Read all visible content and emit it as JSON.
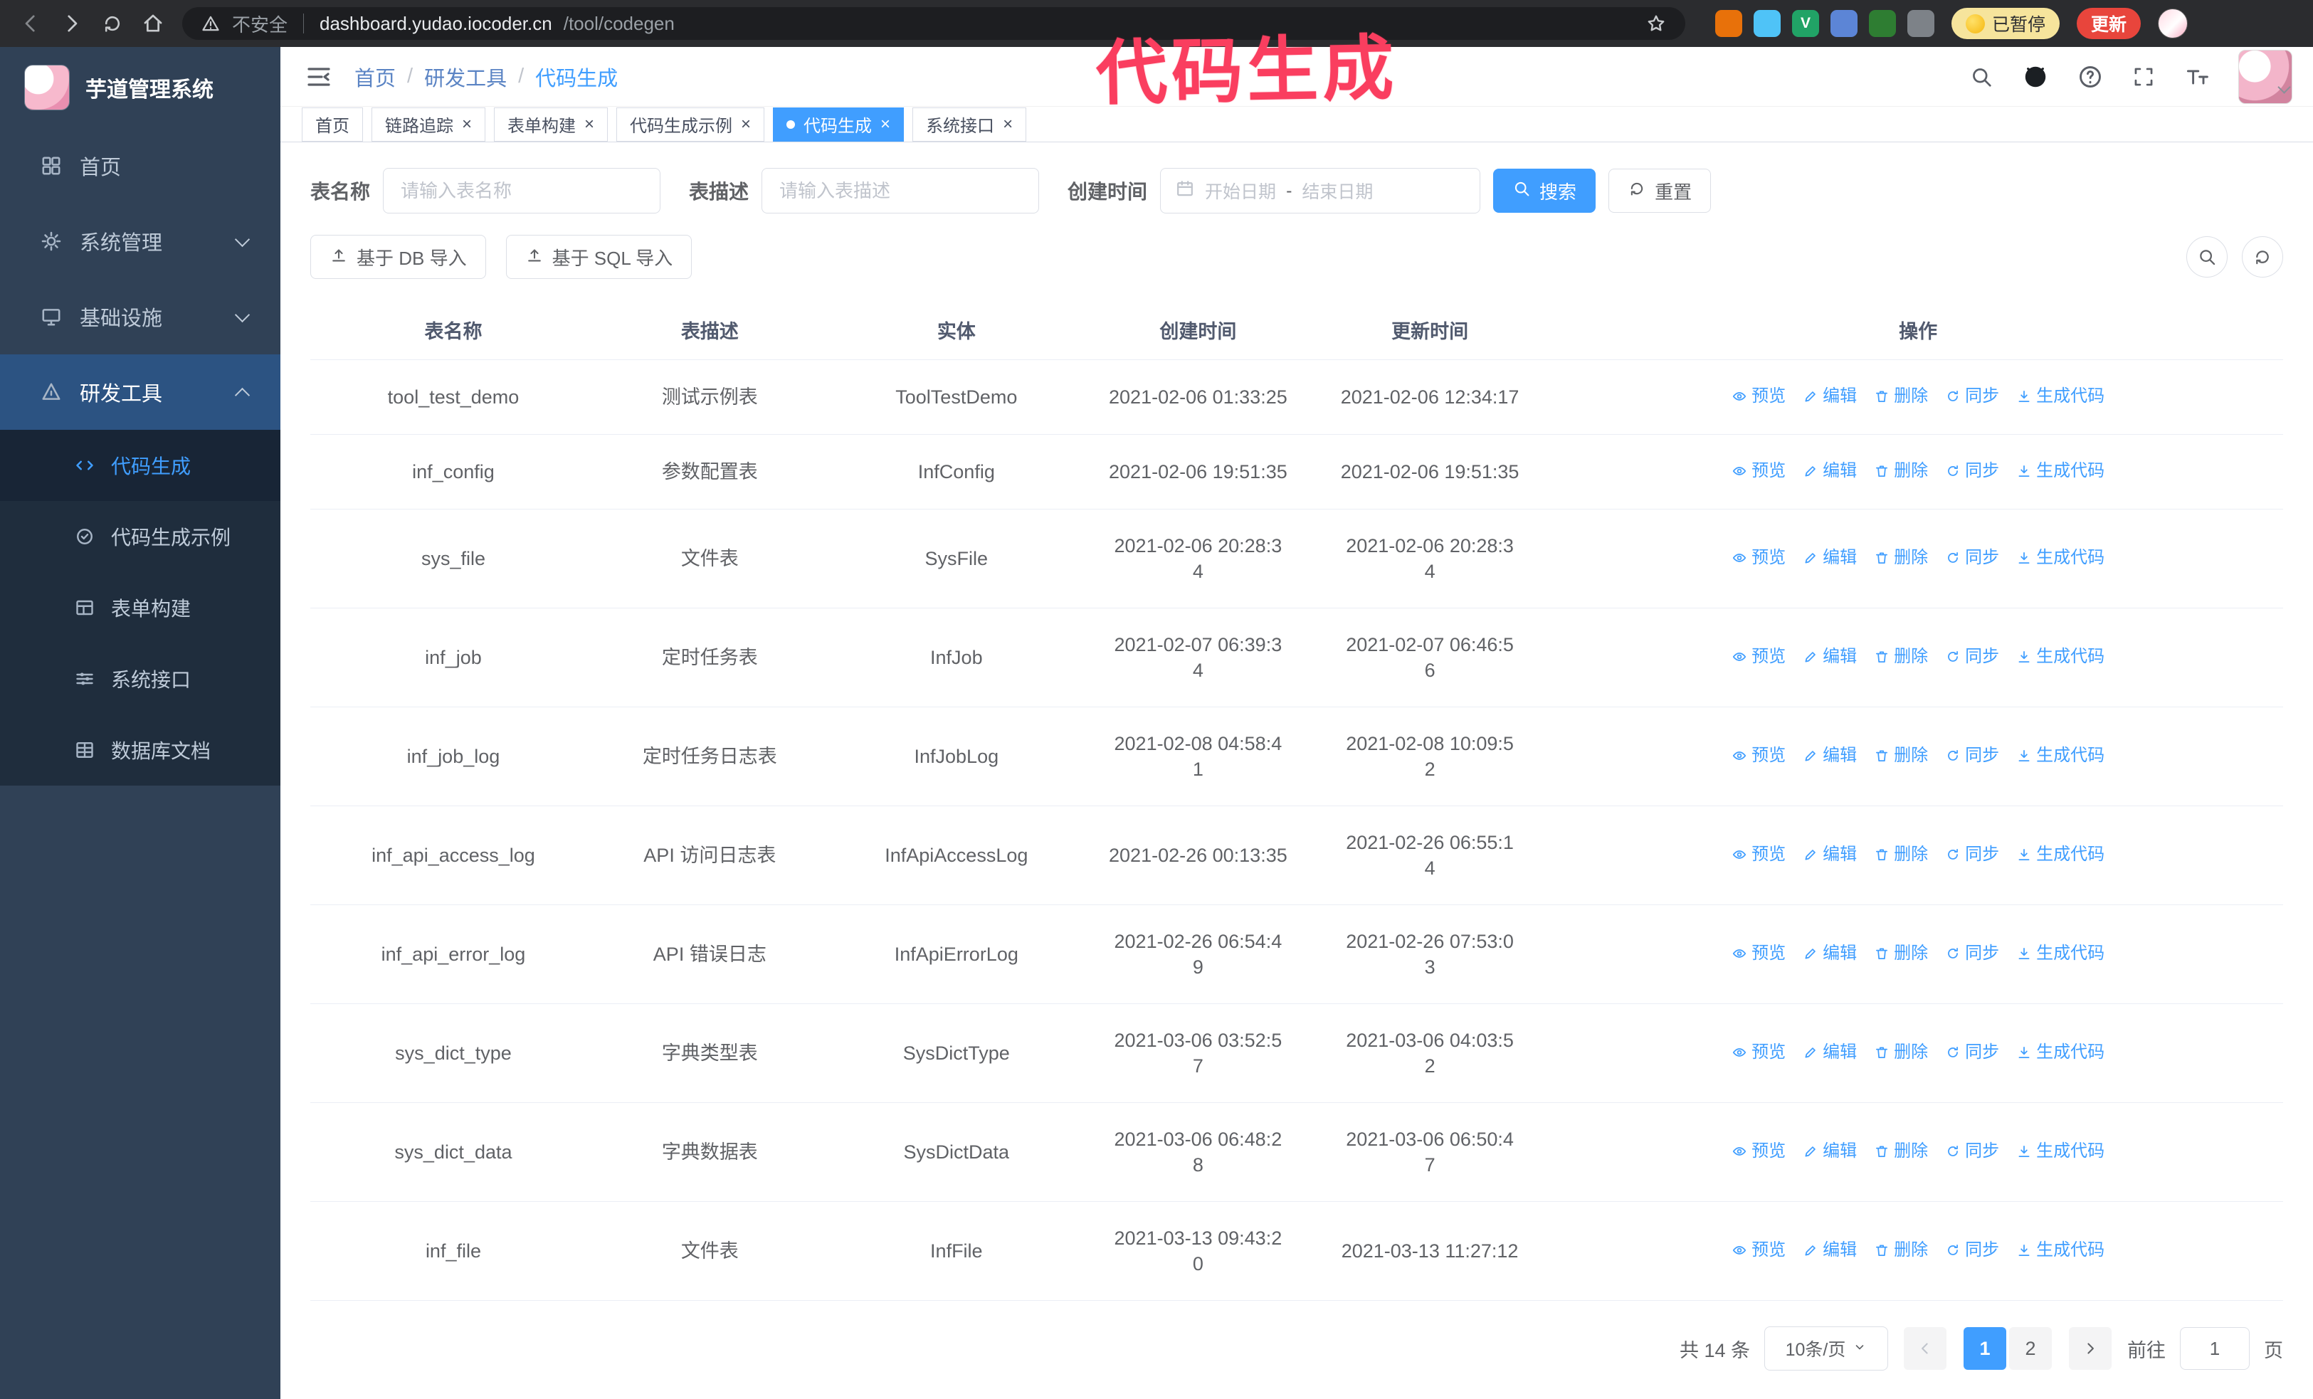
{
  "annotation": {
    "text": "代码生成",
    "color": "#fa3e5f"
  },
  "colors": {
    "primary": "#409eff",
    "sidebar_bg": "#304156",
    "submenu_bg": "#1f2d3d",
    "annotation": "#fa3e5f",
    "update_button": "#e8453c"
  },
  "browser": {
    "security_warning": "不安全",
    "url_host": "dashboard.yudao.iocoder.cn",
    "url_path": "/tool/codegen",
    "paused_badge": "已暂停",
    "update_button": "更新",
    "nav_icons": [
      "back-icon",
      "forward-icon",
      "reload-icon",
      "home2-icon"
    ],
    "extensions": [
      {
        "name": "extension-shield-icon",
        "color": "#e8710a",
        "label": ""
      },
      {
        "name": "extension-drop-icon",
        "color": "#4fc3f7",
        "label": ""
      },
      {
        "name": "extension-v-icon",
        "color": "#21a366",
        "label": "V"
      },
      {
        "name": "extension-people-icon",
        "color": "#5c85d6",
        "label": ""
      },
      {
        "name": "extension-leaf-icon",
        "color": "#2e7d32",
        "label": ""
      },
      {
        "name": "extension-puzzle-icon",
        "color": "#7d8288",
        "label": ""
      }
    ]
  },
  "sidebar": {
    "logo_title": "芋道管理系统",
    "items": [
      {
        "key": "home",
        "label": "首页",
        "icon": "home-icon",
        "expandable": false,
        "expanded": false
      },
      {
        "key": "system",
        "label": "系统管理",
        "icon": "gear-icon",
        "expandable": true,
        "expanded": false
      },
      {
        "key": "infra",
        "label": "基础设施",
        "icon": "infra-icon",
        "expandable": true,
        "expanded": false
      },
      {
        "key": "devtools",
        "label": "研发工具",
        "icon": "tools-icon",
        "expandable": true,
        "expanded": true,
        "children": [
          {
            "key": "codegen",
            "label": "代码生成",
            "icon": "code-icon",
            "active": true
          },
          {
            "key": "codegen-example",
            "label": "代码生成示例",
            "icon": "example-icon",
            "active": false
          },
          {
            "key": "form-builder",
            "label": "表单构建",
            "icon": "form-icon",
            "active": false
          },
          {
            "key": "system-api",
            "label": "系统接口",
            "icon": "api-icon",
            "active": false
          },
          {
            "key": "db-doc",
            "label": "数据库文档",
            "icon": "database-icon",
            "active": false
          }
        ]
      }
    ]
  },
  "header": {
    "breadcrumb": [
      "首页",
      "研发工具",
      "代码生成"
    ]
  },
  "tabs": [
    {
      "label": "首页",
      "closable": false,
      "active": false
    },
    {
      "label": "链路追踪",
      "closable": true,
      "active": false
    },
    {
      "label": "表单构建",
      "closable": true,
      "active": false
    },
    {
      "label": "代码生成示例",
      "closable": true,
      "active": false
    },
    {
      "label": "代码生成",
      "closable": true,
      "active": true
    },
    {
      "label": "系统接口",
      "closable": true,
      "active": false
    }
  ],
  "filters": {
    "table_name_label": "表名称",
    "table_name_placeholder": "请输入表名称",
    "table_desc_label": "表描述",
    "table_desc_placeholder": "请输入表描述",
    "create_time_label": "创建时间",
    "date_start_placeholder": "开始日期",
    "date_separator": "-",
    "date_end_placeholder": "结束日期",
    "search_button": "搜索",
    "reset_button": "重置"
  },
  "toolbar": {
    "import_db_button": "基于 DB 导入",
    "import_sql_button": "基于 SQL 导入"
  },
  "table": {
    "columns": [
      "表名称",
      "表描述",
      "实体",
      "创建时间",
      "更新时间",
      "操作"
    ],
    "actions": [
      {
        "key": "preview",
        "label": "预览",
        "icon": "eye-icon"
      },
      {
        "key": "edit",
        "label": "编辑",
        "icon": "edit-icon"
      },
      {
        "key": "delete",
        "label": "删除",
        "icon": "delete-icon"
      },
      {
        "key": "sync",
        "label": "同步",
        "icon": "sync-icon"
      },
      {
        "key": "generate-code",
        "label": "生成代码",
        "icon": "download-icon"
      }
    ],
    "rows": [
      {
        "name": "tool_test_demo",
        "desc": "测试示例表",
        "entity": "ToolTestDemo",
        "created": "2021-02-06 01:33:25",
        "updated": "2021-02-06 12:34:17"
      },
      {
        "name": "inf_config",
        "desc": "参数配置表",
        "entity": "InfConfig",
        "created": "2021-02-06 19:51:35",
        "updated": "2021-02-06 19:51:35"
      },
      {
        "name": "sys_file",
        "desc": "文件表",
        "entity": "SysFile",
        "created": "2021-02-06 20:28:3\n4",
        "updated": "2021-02-06 20:28:3\n4"
      },
      {
        "name": "inf_job",
        "desc": "定时任务表",
        "entity": "InfJob",
        "created": "2021-02-07 06:39:3\n4",
        "updated": "2021-02-07 06:46:5\n6"
      },
      {
        "name": "inf_job_log",
        "desc": "定时任务日志表",
        "entity": "InfJobLog",
        "created": "2021-02-08 04:58:4\n1",
        "updated": "2021-02-08 10:09:5\n2"
      },
      {
        "name": "inf_api_access_log",
        "desc": "API 访问日志表",
        "entity": "InfApiAccessLog",
        "created": "2021-02-26 00:13:35",
        "updated": "2021-02-26 06:55:1\n4"
      },
      {
        "name": "inf_api_error_log",
        "desc": "API 错误日志",
        "entity": "InfApiErrorLog",
        "created": "2021-02-26 06:54:4\n9",
        "updated": "2021-02-26 07:53:0\n3"
      },
      {
        "name": "sys_dict_type",
        "desc": "字典类型表",
        "entity": "SysDictType",
        "created": "2021-03-06 03:52:5\n7",
        "updated": "2021-03-06 04:03:5\n2"
      },
      {
        "name": "sys_dict_data",
        "desc": "字典数据表",
        "entity": "SysDictData",
        "created": "2021-03-06 06:48:2\n8",
        "updated": "2021-03-06 06:50:4\n7"
      },
      {
        "name": "inf_file",
        "desc": "文件表",
        "entity": "InfFile",
        "created": "2021-03-13 09:43:2\n0",
        "updated": "2021-03-13 11:27:12"
      }
    ]
  },
  "pagination": {
    "total_text": "共 14 条",
    "page_size": "10条/页",
    "pages": [
      "1",
      "2"
    ],
    "active_page": "1",
    "goto_label": "前往",
    "goto_value": "1",
    "goto_suffix": "页"
  }
}
